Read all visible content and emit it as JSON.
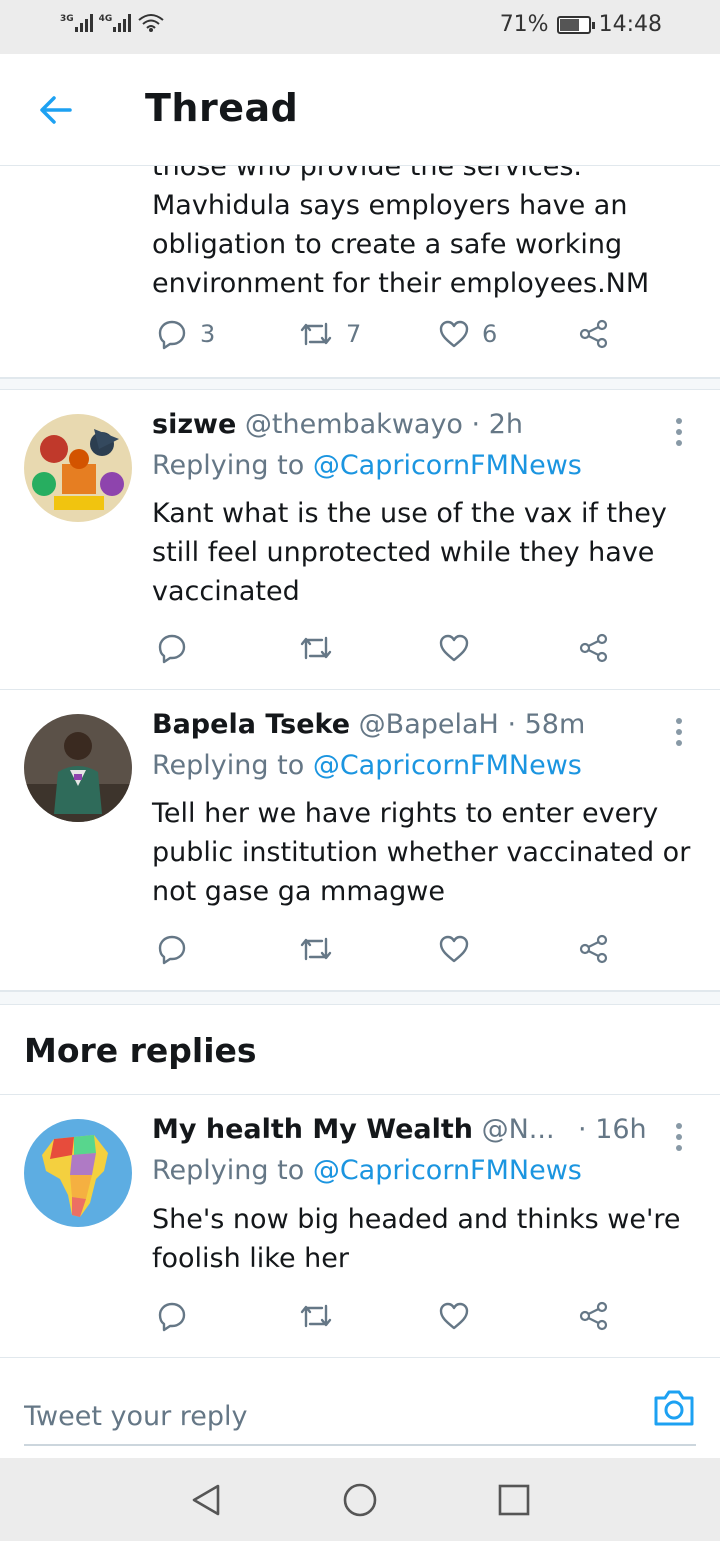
{
  "status_bar": {
    "net1": "3G",
    "net2": "4G",
    "battery": "71%",
    "battery_level": 0.71,
    "time": "14:48"
  },
  "header": {
    "title": "Thread"
  },
  "main_tweet": {
    "clipped_line": "those who provide the services.",
    "lines": [
      "Mavhidula says employers have an",
      "obligation to create a safe working",
      "environment for their employees.NM"
    ],
    "reply_count": "3",
    "retweet_count": "7",
    "like_count": "6"
  },
  "replies": [
    {
      "name": "sizwe",
      "handle": "@thembakwayo",
      "sep": "·",
      "time": "2h",
      "replying_prefix": "Replying to",
      "replying_to": "@CapricornFMNews",
      "lines": [
        "Kant what is the use of the vax if they",
        "still feel unprotected while they have",
        "vaccinated"
      ]
    },
    {
      "name": "Bapela Tseke",
      "handle": "@BapelaH",
      "sep": "·",
      "time": "58m",
      "replying_prefix": "Replying to",
      "replying_to": "@CapricornFMNews",
      "lines": [
        "Tell her we have rights to enter every",
        "public institution whether vaccinated or",
        "not gase ga mmagwe"
      ]
    }
  ],
  "more_replies": {
    "title": "More replies",
    "items": [
      {
        "name": "My health My Wealth",
        "handle": "@N...",
        "sep": "·",
        "time": "16h",
        "replying_prefix": "Replying to",
        "replying_to": "@CapricornFMNews",
        "lines": [
          "She's now big headed and thinks we're",
          "foolish like her"
        ]
      }
    ]
  },
  "reply_bar": {
    "placeholder": "Tweet your reply"
  },
  "colors": {
    "accent": "#1da1f2",
    "link": "#1b95e0",
    "secondary_text": "#657786",
    "divider": "#e1e8ed"
  },
  "icons": [
    "back-arrow-icon",
    "reply-icon",
    "retweet-icon",
    "like-icon",
    "share-icon",
    "more-icon",
    "camera-icon",
    "nav-back-icon",
    "nav-home-icon",
    "nav-recents-icon",
    "wifi-icon",
    "signal-icon",
    "battery-icon"
  ]
}
